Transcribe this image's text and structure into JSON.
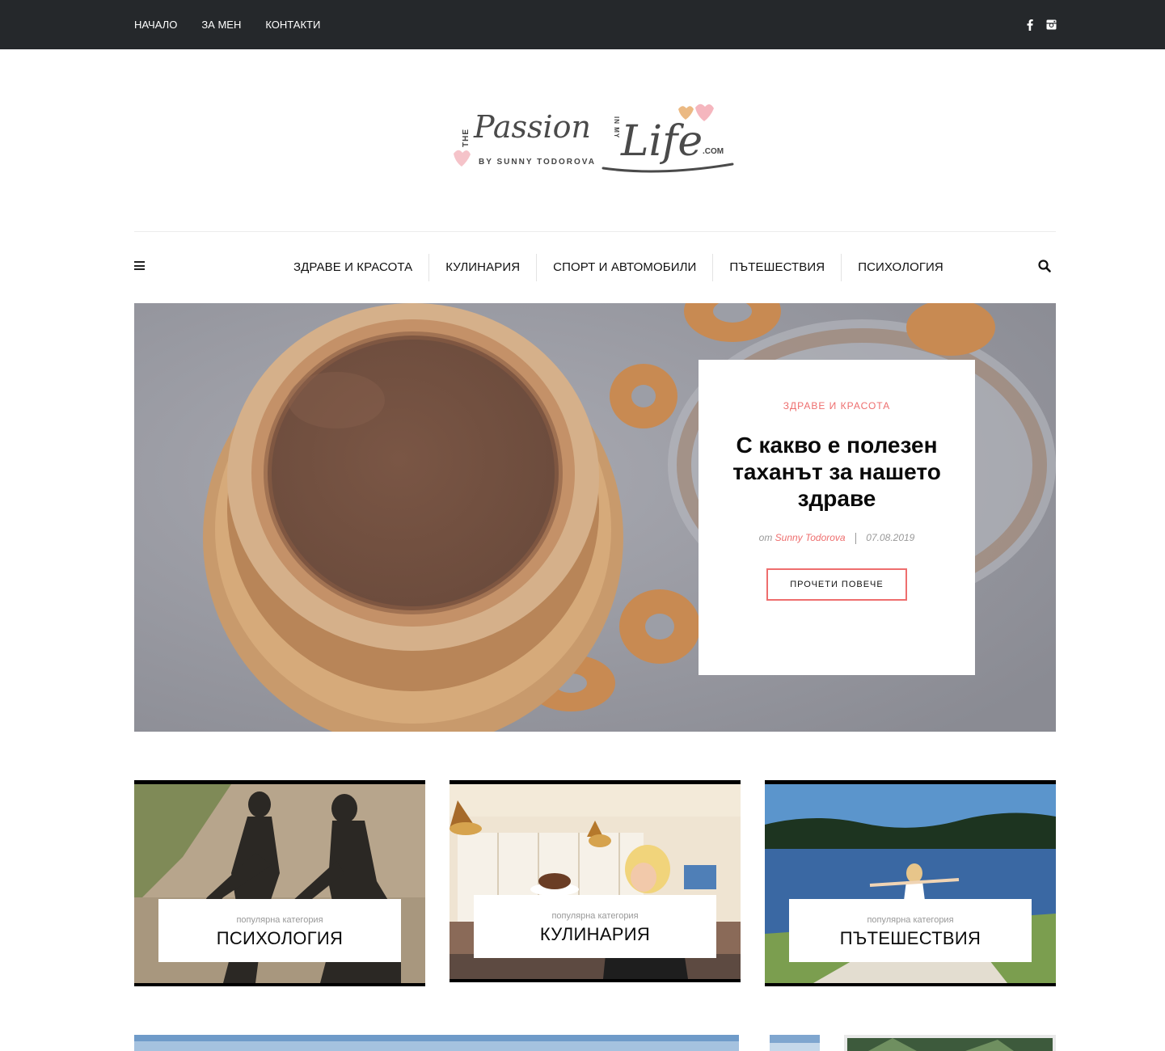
{
  "topbar": {
    "links": [
      "НАЧАЛО",
      "ЗА МЕН",
      "КОНТАКТИ"
    ],
    "social": [
      "facebook-icon",
      "instagram-icon"
    ]
  },
  "logo": {
    "the": "THE",
    "passion": "Passion",
    "in_my": "IN MY",
    "life": "Life",
    "com": ".COM",
    "byline": "BY SUNNY TODOROVA"
  },
  "mainnav": {
    "items": [
      "ЗДРАВЕ И КРАСОТА",
      "КУЛИНАРИЯ",
      "СПОРТ И АВТОМОБИЛИ",
      "ПЪТЕШЕСТВИЯ",
      "ПСИХОЛОГИЯ"
    ]
  },
  "hero": {
    "category": "ЗДРАВЕ И КРАСОТА",
    "title": "С какво е полезен таханът за нашето здраве",
    "by": "от",
    "author": "Sunny Todorova",
    "date": "07.08.2019",
    "button": "ПРОЧЕТИ ПОВЕЧЕ"
  },
  "categories": [
    {
      "label": "популярна категория",
      "name": "ПСИХОЛОГИЯ"
    },
    {
      "label": "популярна категория",
      "name": "КУЛИНАРИЯ"
    },
    {
      "label": "популярна категория",
      "name": "ПЪТЕШЕСТВИЯ"
    }
  ],
  "colors": {
    "topbar": "#25282b",
    "accent": "#ee6e6e"
  }
}
